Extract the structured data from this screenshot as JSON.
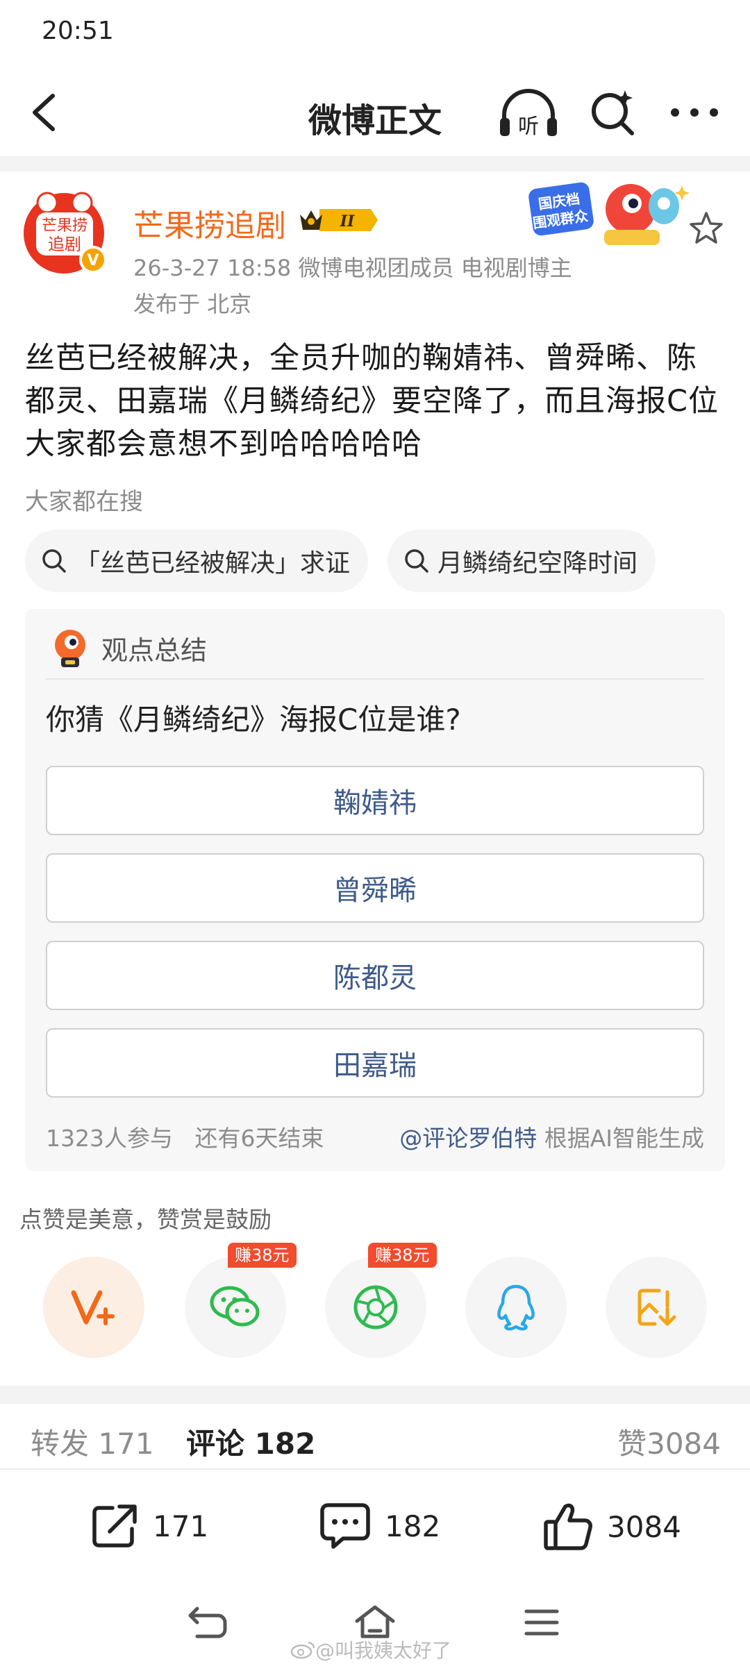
{
  "status": {
    "time": "20:51"
  },
  "nav": {
    "title": "微博正文"
  },
  "post": {
    "author": "芒果捞追剧",
    "level_badge": "II",
    "avatar_text": "芒果捞\n追剧",
    "meta": "26-3-27 18:58  微博电视团成员 电视剧博主",
    "location": "发布于 北京",
    "decor_text": "国庆档\n围观群众",
    "text": "丝芭已经被解决，全员升咖的鞠婧祎、曾舜晞、陈都灵、田嘉瑞《月鳞绮纪》要空降了，而且海报C位大家都会意想不到哈哈哈哈哈"
  },
  "hot_search": {
    "label": "大家都在搜",
    "chips": [
      "「丝芭已经被解决」求证",
      "月鳞绮纪空降时间"
    ]
  },
  "opinion": {
    "title": "观点总结",
    "question": "你猜《月鳞绮纪》海报C位是谁?",
    "options": [
      "鞠婧祎",
      "曾舜晞",
      "陈都灵",
      "田嘉瑞"
    ],
    "participants": "1323人参与",
    "remaining": "还有6天结束",
    "source_at": "@评论罗伯特",
    "source_suffix": " 根据AI智能生成"
  },
  "reward": {
    "tip": "点赞是美意，赞赏是鼓励",
    "earn_tag": "赚38元"
  },
  "stats": {
    "repost_label": "转发",
    "repost_count": "171",
    "comment_label": "评论",
    "comment_count": "182",
    "like_label": "赞",
    "like_count": "3084"
  },
  "actions": {
    "repost": "171",
    "comment": "182",
    "like": "3084"
  },
  "watermark": "@叫我姨太好了",
  "colors": {
    "accent_orange": "#f26a1b",
    "link_blue": "#3e5a8a",
    "wechat_green": "#2fba4f",
    "qq_blue": "#2aa7e8",
    "save_yellow": "#f2a516"
  }
}
